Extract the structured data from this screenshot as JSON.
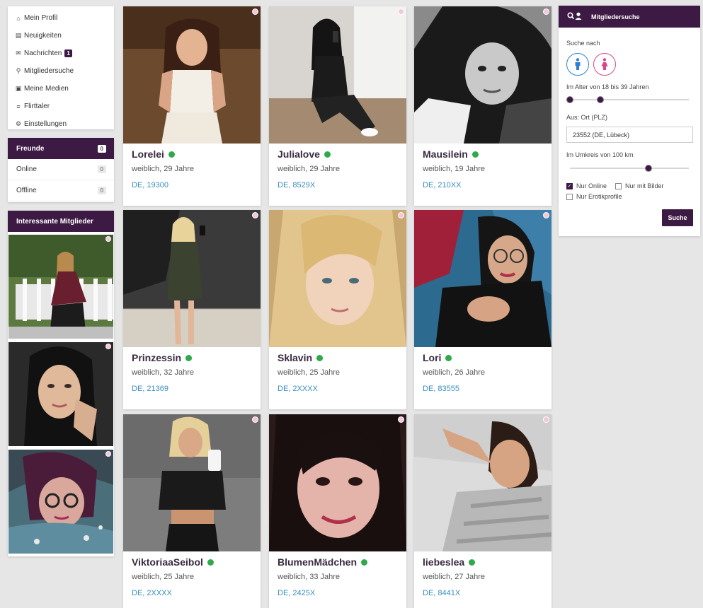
{
  "menu": {
    "items": [
      {
        "icon": "home-icon",
        "glyph": "⌂",
        "label": "Mein Profil"
      },
      {
        "icon": "newspaper-icon",
        "glyph": "▤",
        "label": "Neuigkeiten"
      },
      {
        "icon": "chat-icon",
        "glyph": "✉",
        "label": "Nachrichten",
        "badge": "1"
      },
      {
        "icon": "search-icon",
        "glyph": "⚲",
        "label": "Mitgliedersuche"
      },
      {
        "icon": "media-icon",
        "glyph": "▣",
        "label": "Meine Medien"
      },
      {
        "icon": "coins-icon",
        "glyph": "≡",
        "label": "Flirttaler"
      },
      {
        "icon": "gear-icon",
        "glyph": "⚙",
        "label": "Einstellungen"
      }
    ]
  },
  "friends": {
    "title": "Freunde",
    "count": "0",
    "rows": [
      {
        "label": "Online",
        "count": "0"
      },
      {
        "label": "Offline",
        "count": "0"
      }
    ]
  },
  "interesting": {
    "title": "Interessante Mitglieder"
  },
  "members": [
    {
      "name": "Lorelei",
      "meta": "weiblich, 29 Jahre",
      "loc": "DE, 19300"
    },
    {
      "name": "Julialove",
      "meta": "weiblich, 29 Jahre",
      "loc": "DE, 8529X"
    },
    {
      "name": "Mausilein",
      "meta": "weiblich, 19 Jahre",
      "loc": "DE, 210XX"
    },
    {
      "name": "Prinzessin",
      "meta": "weiblich, 32 Jahre",
      "loc": "DE, 21369"
    },
    {
      "name": "Sklavin",
      "meta": "weiblich, 25 Jahre",
      "loc": "DE, 2XXXX"
    },
    {
      "name": "Lori",
      "meta": "weiblich, 26 Jahre",
      "loc": "DE, 83555"
    },
    {
      "name": "ViktoriaaSeibol",
      "meta": "weiblich, 25 Jahre",
      "loc": "DE, 2XXXX"
    },
    {
      "name": "BlumenMädchen",
      "meta": "weiblich, 33 Jahre",
      "loc": "DE, 2425X"
    },
    {
      "name": "liebeslea",
      "meta": "weiblich, 27 Jahre",
      "loc": "DE, 8441X"
    }
  ],
  "search": {
    "title": "Mitgliedersuche",
    "search_for": "Suche nach",
    "age_label": "Im Alter von 18 bis 39 Jahren",
    "age_min": 18,
    "age_max": 39,
    "location_label": "Aus: Ort (PLZ)",
    "location_value": "23552 (DE, Lübeck)",
    "radius_label": "Im Umkreis von 100 km",
    "radius_km": 100,
    "only_online": "Nur Online",
    "only_online_checked": true,
    "only_with_pics": "Nur mit Bilder",
    "only_erotic": "Nur Erotikprofile",
    "submit": "Suche"
  },
  "colors": {
    "brand": "#3d1a44",
    "online": "#2eaa4a",
    "link": "#3a8ebd",
    "male": "#2d7fd3",
    "female": "#d9478b"
  }
}
